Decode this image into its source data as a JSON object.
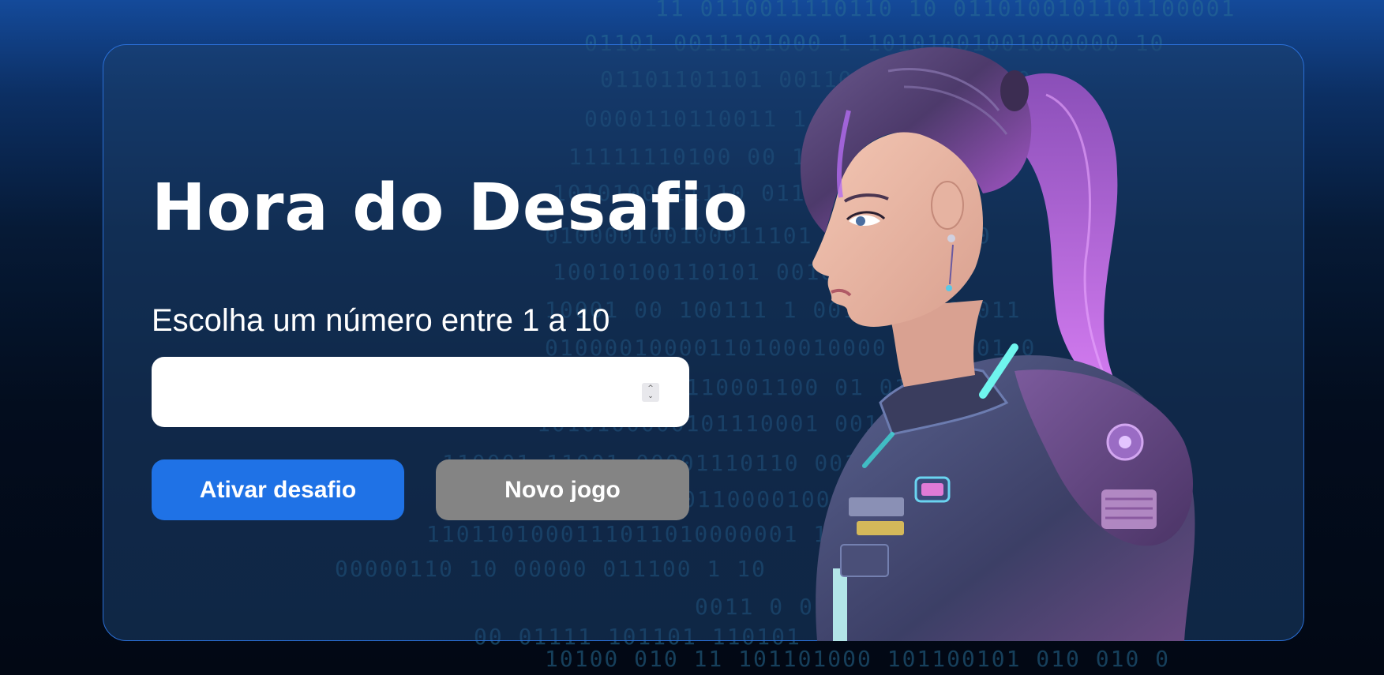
{
  "challenge": {
    "title": "Hora do Desafio",
    "prompt_label": "Escolha um número entre 1 a 10",
    "number_input": {
      "value": "",
      "placeholder": ""
    },
    "buttons": {
      "activate": "Ativar desafio",
      "new_game": "Novo jogo"
    }
  },
  "background": {
    "binary_lines": [
      "11 0110011110110 10 0110100101101100001",
      "01101 0011101000 1  10101001001000000 10",
      "01101101101  00110  1011011 1 0",
      "0000110110011  1 10  101101000010",
      "11111110100   00 11  11000011 0 0",
      "1010100011110  0111  001011",
      "010000100100011101  1 0   01 10 0",
      "10010100110101 00100  01 1001",
      "10001 00 100111 1  001001  0100011",
      "01000010000110100010000  0000101  0",
      "0 10 00001110001100  01 01 1",
      "1010100000101110001 00100 01000",
      "110001 11001 00001110110  00110",
      "01 000 011010001100001000 01010",
      "1101101000111011010000001  11 0 11",
      "00000110  10   00000  011100 1 10",
      "0011  0  01 1110 0",
      "00 01111  101101  110101",
      "10100 010 11 101101000 101100101 010 010 0"
    ]
  },
  "colors": {
    "accent_button": "#1f72e6",
    "secondary_button": "#848484",
    "card_border": "#2a6fd6",
    "title_text": "#ffffff"
  },
  "icons": {
    "spinner": "up-down-stepper-icon",
    "illustration": "astronaut-woman-portrait"
  }
}
